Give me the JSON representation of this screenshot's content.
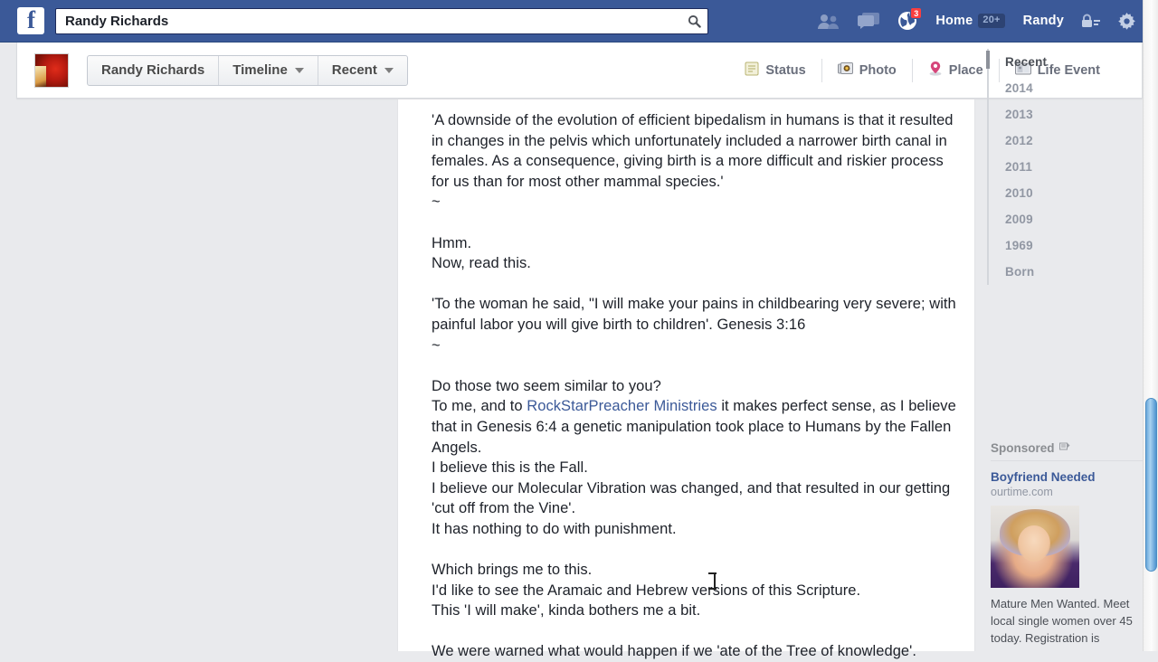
{
  "topbar": {
    "logo": "f",
    "search": {
      "value": "Randy Richards",
      "placeholder": "Search",
      "icon": "search-icon"
    },
    "icons": [
      {
        "name": "friend-requests-icon",
        "badge": ""
      },
      {
        "name": "messages-icon",
        "badge": ""
      },
      {
        "name": "notifications-globe-icon",
        "badge": "3"
      }
    ],
    "home_label": "Home",
    "home_badge": "20+",
    "profile_name": "Randy",
    "privacy_icon": "privacy-lock-icon",
    "settings_icon": "settings-gear-icon"
  },
  "subnav": {
    "avatar": "profile-avatar",
    "buttons": [
      {
        "label": "Randy Richards",
        "caret": false
      },
      {
        "label": "Timeline",
        "caret": true
      },
      {
        "label": "Recent",
        "caret": true
      }
    ],
    "composer": [
      {
        "label": "Status",
        "icon": "status-note-icon"
      },
      {
        "label": "Photo",
        "icon": "photo-camera-icon"
      },
      {
        "label": "Place",
        "icon": "place-pin-icon"
      },
      {
        "label": "Life Event",
        "icon": "life-event-flag-icon"
      }
    ]
  },
  "post": {
    "lines": [
      "'A downside of the evolution of efficient bipedalism in humans is that it resulted in changes in the pelvis which unfortunately included a narrower birth canal in females. As a consequence, giving birth is a more difficult and riskier process for us than for most other mammal species.'",
      "~",
      "",
      "Hmm.",
      "Now, read this.",
      "",
      "'To the woman he said, \"I will make your pains in childbearing very severe; with painful labor you will give birth to children'. Genesis 3:16",
      "~",
      "",
      "Do those two seem similar to you?"
    ],
    "link_line_prefix": "To me, and to ",
    "link_text": "RockStarPreacher Ministries",
    "link_line_suffix": " it makes perfect sense, as I believe that in Genesis 6:4 a genetic manipulation took place to Humans by the Fallen Angels.",
    "lines_after": [
      "I believe this is the Fall.",
      "I believe our Molecular Vibration was changed, and that resulted in our getting 'cut off from the Vine'.",
      "It has nothing to do with punishment.",
      "",
      "Which brings me to this.",
      "I'd like to see the Aramaic and Hebrew versions of this Scripture.",
      "This 'I will make', kinda bothers me a bit.",
      "",
      "We were warned what would happen if we 'ate of the Tree of knowledge'."
    ]
  },
  "year_nav": {
    "items": [
      {
        "label": "Recent",
        "active": true
      },
      {
        "label": "2014",
        "active": false
      },
      {
        "label": "2013",
        "active": false
      },
      {
        "label": "2012",
        "active": false
      },
      {
        "label": "2011",
        "active": false
      },
      {
        "label": "2010",
        "active": false
      },
      {
        "label": "2009",
        "active": false
      },
      {
        "label": "1969",
        "active": false
      },
      {
        "label": "Born",
        "active": false
      }
    ]
  },
  "sponsored": {
    "heading": "Sponsored",
    "heading_icon": "sponsored-info-icon",
    "ad": {
      "title": "Boyfriend Needed",
      "url": "ourtime.com",
      "image": "ad-photo-woman",
      "body": "Mature Men Wanted. Meet local single women over 45 today. Registration is"
    }
  },
  "colors": {
    "fb_blue": "#3b5998",
    "page_bg": "#e9eaed",
    "link": "#3b5998",
    "badge_red": "#fa3e3e",
    "scrollbar_thumb": "#6aa7db"
  }
}
